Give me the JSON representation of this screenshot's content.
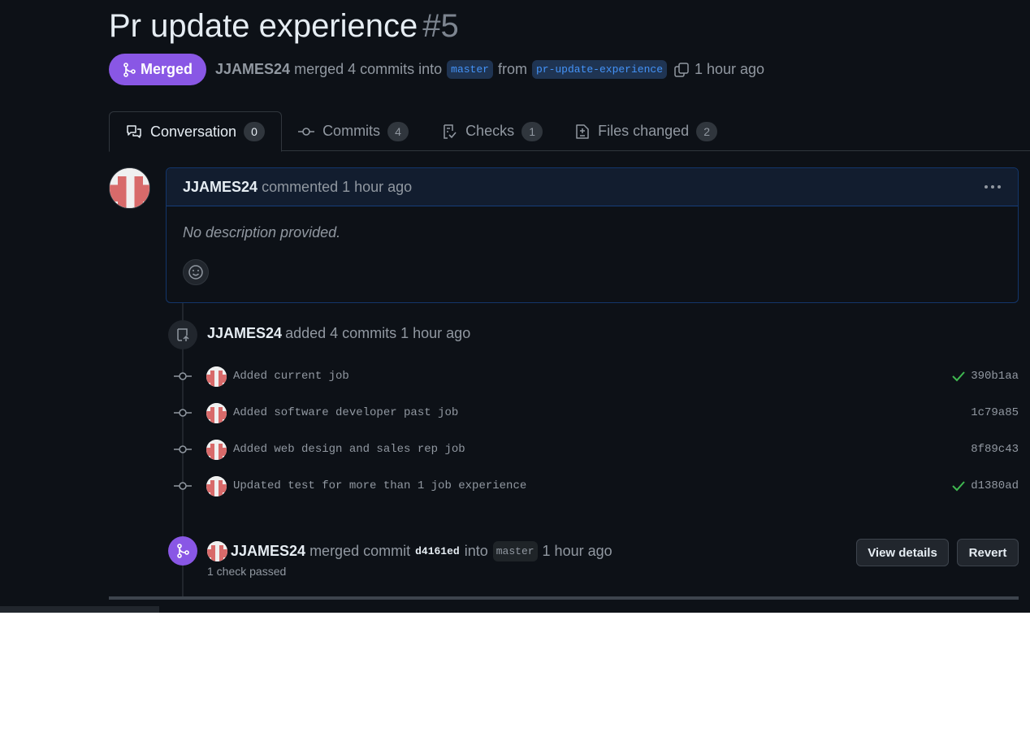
{
  "pr": {
    "title": "Pr update experience",
    "number": "#5",
    "state_label": "Merged",
    "author": "JJAMES24",
    "merged_text": "merged 4 commits into",
    "base_branch": "master",
    "from_text": "from",
    "head_branch": "pr-update-experience",
    "time": "1 hour ago"
  },
  "tabs": [
    {
      "label": "Conversation",
      "count": "0",
      "icon": "comment-discussion-icon"
    },
    {
      "label": "Commits",
      "count": "4",
      "icon": "git-commit-icon"
    },
    {
      "label": "Checks",
      "count": "1",
      "icon": "checklist-icon"
    },
    {
      "label": "Files changed",
      "count": "2",
      "icon": "file-diff-icon"
    }
  ],
  "comment": {
    "author": "JJAMES24",
    "action": "commented 1 hour ago",
    "body": "No description provided."
  },
  "push_event": {
    "author": "JJAMES24",
    "text": "added 4 commits 1 hour ago"
  },
  "commits": [
    {
      "message": "Added current job",
      "sha": "390b1aa",
      "checked": true
    },
    {
      "message": "Added software developer past job",
      "sha": "1c79a85",
      "checked": false
    },
    {
      "message": "Added web design and sales rep job",
      "sha": "8f89c43",
      "checked": false
    },
    {
      "message": "Updated test for more than 1 job experience",
      "sha": "d1380ad",
      "checked": true
    }
  ],
  "merge_event": {
    "author": "JJAMES24",
    "text1": "merged commit",
    "sha": "d4161ed",
    "text2": "into",
    "branch": "master",
    "time": "1 hour ago",
    "checks": "1 check passed",
    "view_details_label": "View details",
    "revert_label": "Revert"
  },
  "colors": {
    "background": "#0d1117",
    "merged_purple": "#8957e5",
    "branch_blue": "#4493f8",
    "check_green": "#3fb950"
  }
}
